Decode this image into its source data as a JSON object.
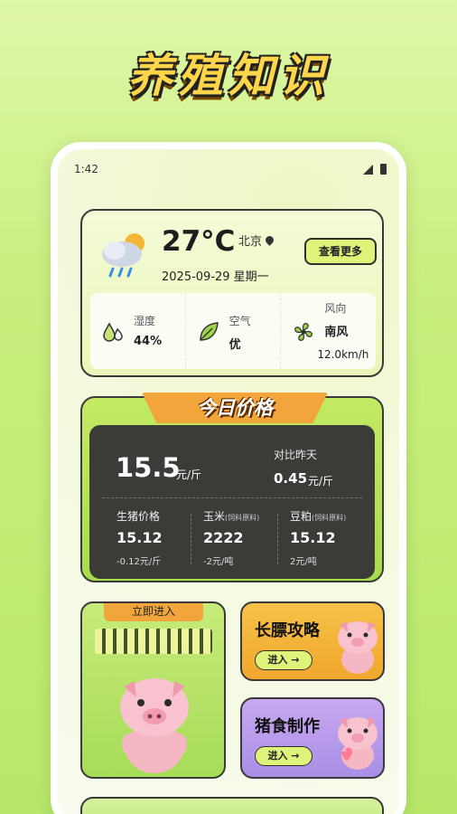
{
  "hero": {
    "title": "养殖知识"
  },
  "statusbar": {
    "time": "1:42"
  },
  "weather": {
    "temperature": "27°C",
    "city": "北京",
    "date": "2025-09-29 星期一",
    "more_label": "查看更多",
    "metrics": [
      {
        "label": "湿度",
        "value": "44%",
        "icon": "humidity-icon"
      },
      {
        "label": "空气",
        "value": "优",
        "icon": "leaf-icon"
      },
      {
        "label": "风向",
        "value": "南风",
        "sub": "12.0km/h",
        "icon": "fan-icon"
      }
    ]
  },
  "price": {
    "title": "今日价格",
    "main_value": "15.5",
    "main_unit": "元/斤",
    "compare_label": "对比昨天",
    "compare_value": "0.45",
    "compare_unit": "元/斤",
    "items": [
      {
        "label": "生猪价格",
        "note": "",
        "value": "15.12",
        "change": "-0.12元/斤"
      },
      {
        "label": "玉米",
        "note": "(饲料原料)",
        "value": "2222",
        "change": "-2元/吨"
      },
      {
        "label": "豆粕",
        "note": "(饲料原料)",
        "value": "15.12",
        "change": "2元/吨"
      }
    ]
  },
  "cards": {
    "enter_tag": "立即进入",
    "guide_title": "长膘攻略",
    "guide_btn": "进入 →",
    "feed_title": "猪食制作",
    "feed_btn": "进入 →"
  },
  "colors": {
    "accent": "#dff27a",
    "orange": "#f1a53a",
    "dark": "#3b3b38"
  }
}
